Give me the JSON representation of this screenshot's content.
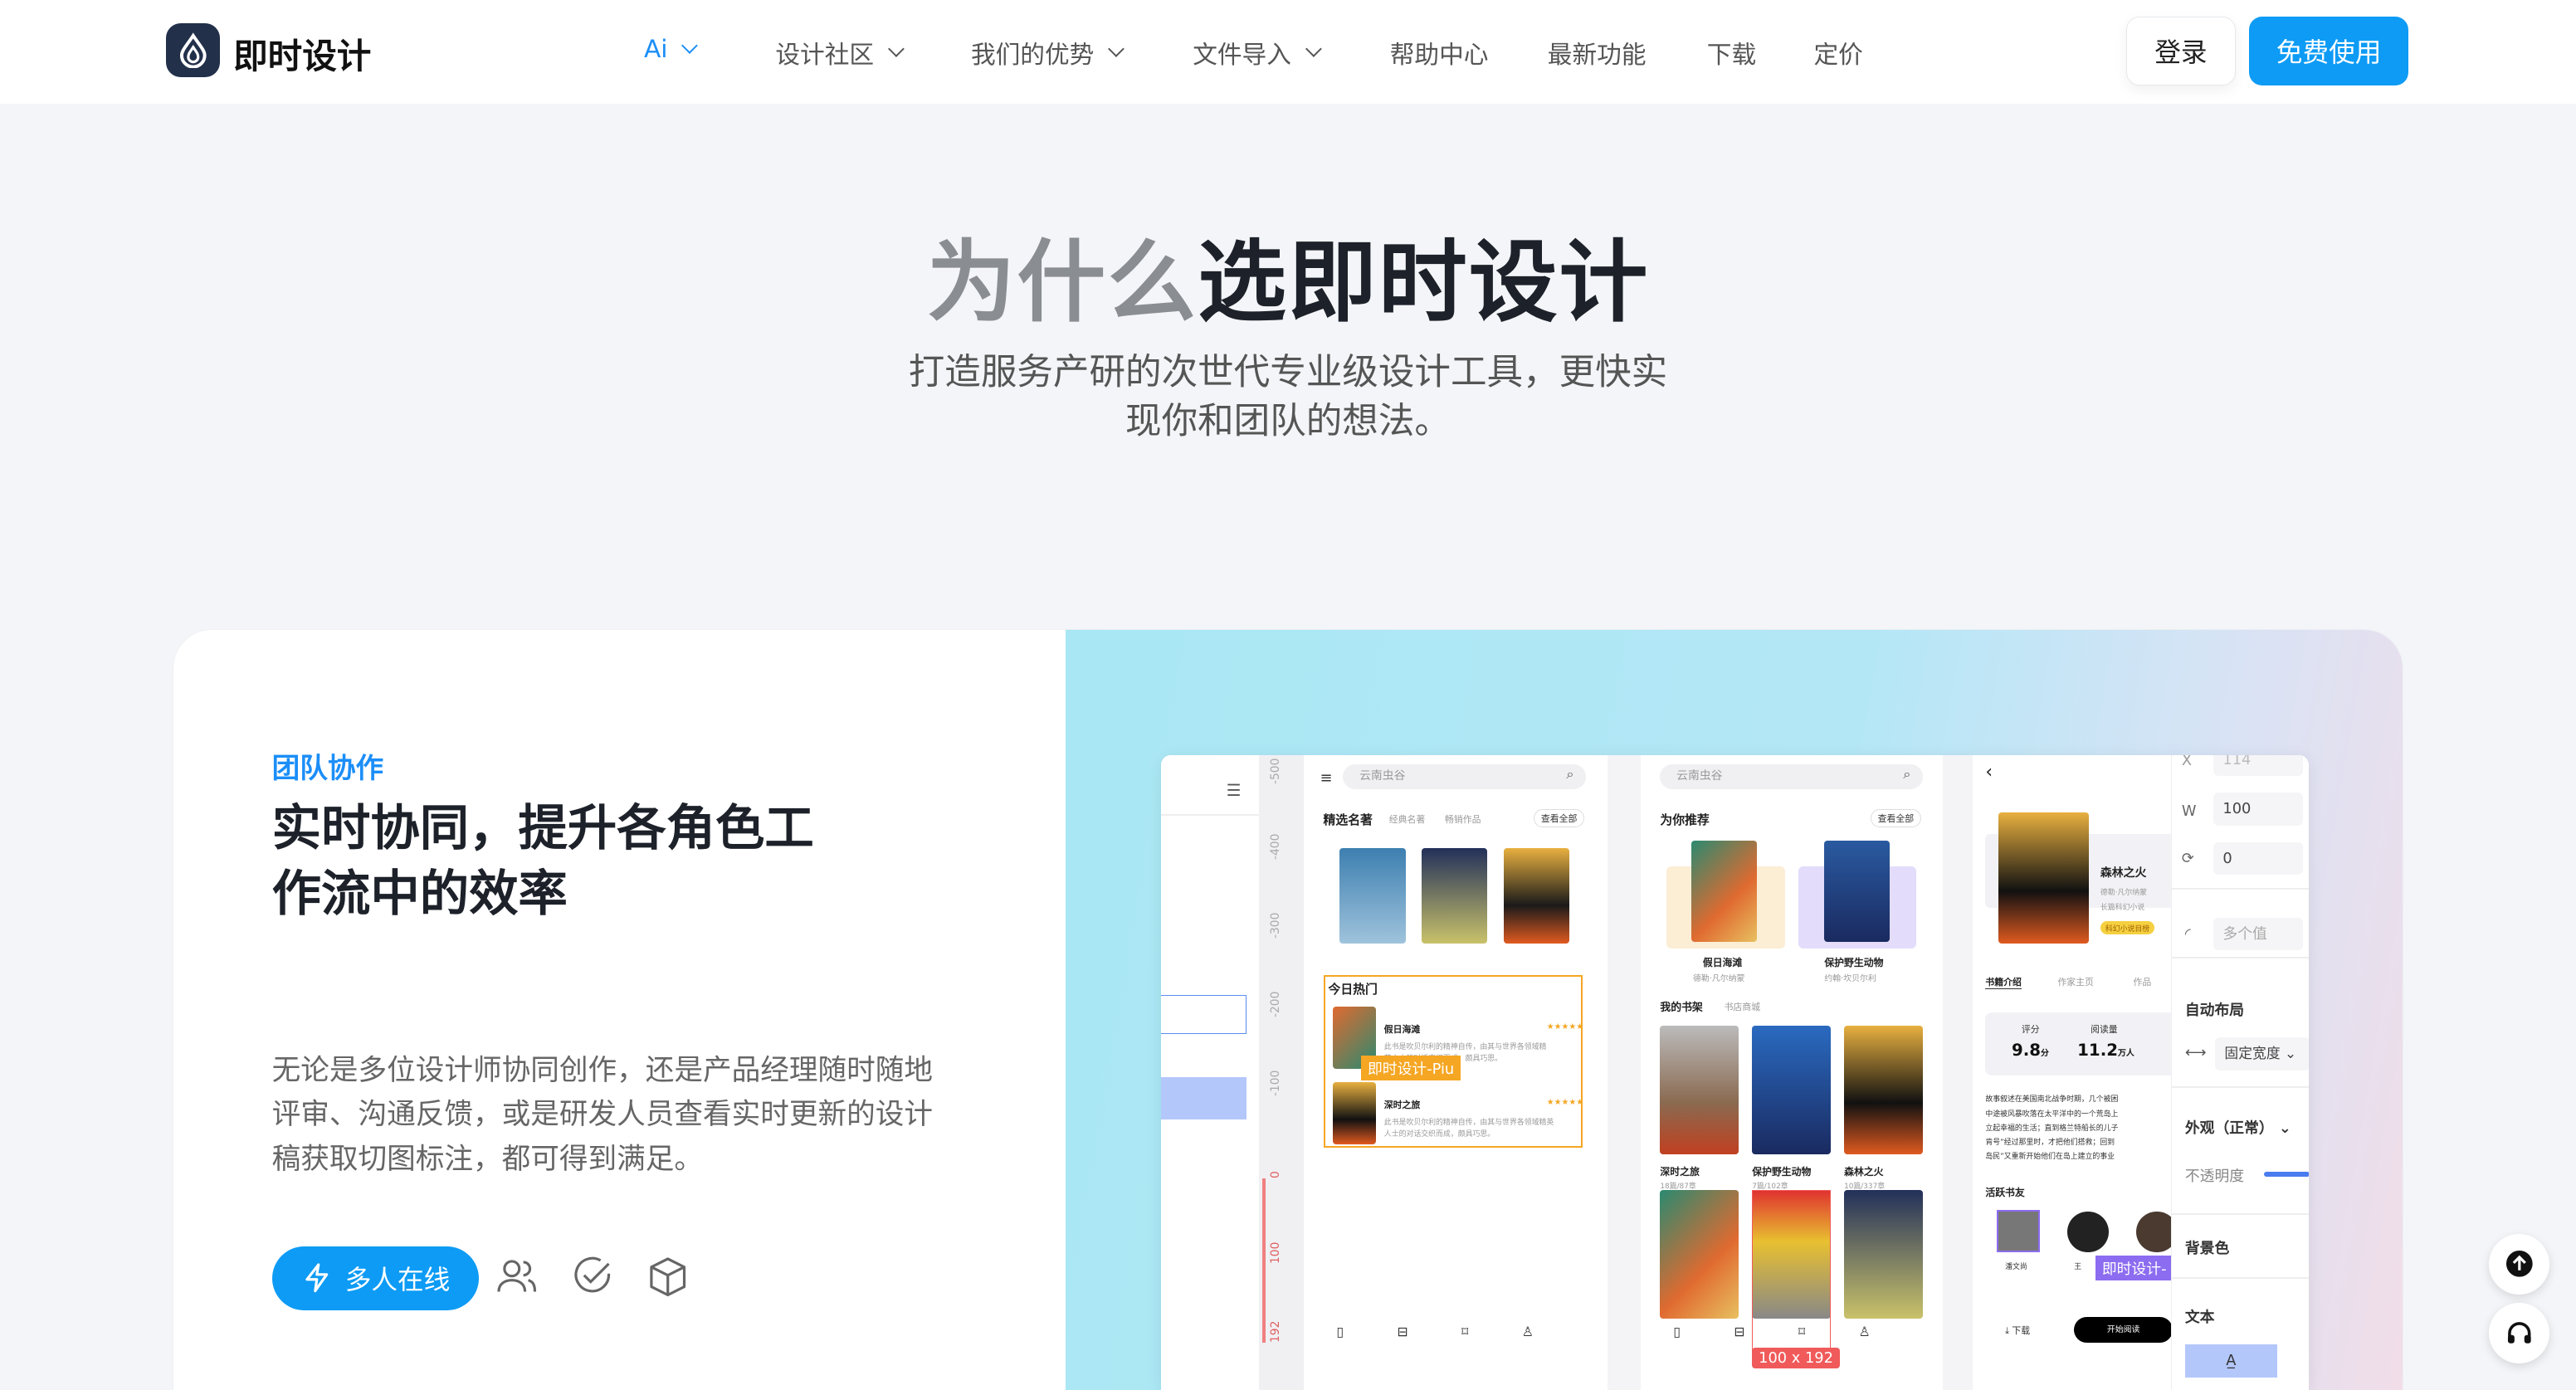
{
  "brand": {
    "name": "即时设计"
  },
  "nav": {
    "items": [
      {
        "label": "Ai",
        "has_dropdown": true,
        "active": true
      },
      {
        "label": "设计社区",
        "has_dropdown": true
      },
      {
        "label": "我们的优势",
        "has_dropdown": true
      },
      {
        "label": "文件导入",
        "has_dropdown": true
      },
      {
        "label": "帮助中心"
      },
      {
        "label": "最新功能"
      },
      {
        "label": "下载"
      },
      {
        "label": "定价"
      }
    ],
    "login": "登录",
    "free": "免费使用"
  },
  "hero": {
    "title_gray": "为什么",
    "title_dark": "选即时设计",
    "subtitle_1": "打造服务产研的次世代专业级设计工具，更快实",
    "subtitle_2": "现你和团队的想法。"
  },
  "feature": {
    "tag": "团队协作",
    "heading_1": "实时协同，提升各角色工",
    "heading_2": "作流中的效率",
    "para_1": "无论是多位设计师协同创作，还是产品经理随时随地",
    "para_2": "评审、沟通反馈，或是研发人员查看实时更新的设计",
    "para_3": "稿获取切图标注，都可得到满足。",
    "button": "多人在线",
    "icons": [
      "users-icon",
      "check-circle-icon",
      "cube-icon"
    ]
  },
  "mockup": {
    "ruler": [
      "-500",
      "-400",
      "-300",
      "-200",
      "-100",
      "0",
      "100",
      "192"
    ],
    "phone1": {
      "search": "云南虫谷",
      "tabs": [
        "精选名著",
        "经典名著",
        "畅销作品"
      ],
      "see_all": "查看全部",
      "hot": "今日热门",
      "items": [
        {
          "title": "假日海滩",
          "desc_1": "此书是吹贝尔利的精神自传，由其与世界各领域精",
          "desc_2": "英人士的对话交织而成，颇具巧思。"
        },
        {
          "title": "深时之旅",
          "desc_1": "此书是吹贝尔利的精神自传，由其与世界各领域精英",
          "desc_2": "人士的对话交织而成，颇具巧思。"
        }
      ],
      "cursor_tag": "即时设计-Piu"
    },
    "phone2": {
      "search": "云南虫谷",
      "section": "为你推荐",
      "see_all": "查看全部",
      "recs": [
        {
          "title": "假日海滩",
          "author": "德勒·凡尔纳蒙"
        },
        {
          "title": "保护野生动物",
          "author": "约翰·坎贝尔利"
        }
      ],
      "shelf_tabs": [
        "我的书架",
        "书店商城"
      ],
      "shelf": [
        {
          "title": "深时之旅",
          "meta": "18篇/87章"
        },
        {
          "title": "保护野生动物",
          "meta": "7篇/102章"
        },
        {
          "title": "森林之火",
          "meta": "10篇/337章"
        }
      ],
      "size_label": "100 x 192"
    },
    "phone3": {
      "title": "森林之火",
      "author": "德勒·凡尔纳蒙",
      "genre": "长篇科幻小说",
      "badge": "科幻小说目榜",
      "tabs": [
        "书籍介绍",
        "作家主页",
        "作品"
      ],
      "score_label": "评分",
      "score": "9.8",
      "score_unit": "分",
      "reads_label": "阅读量",
      "reads": "11.2",
      "reads_unit": "万人",
      "desc": [
        "故事叙述在美国南北战争时期，几个被困",
        "中途被风暴吹落在太平洋中的一个荒岛上",
        "立起幸福的生活；直到格兰特船长的儿子",
        "肯号”经过那里时，才把他们搭救；回到",
        "岛民”又重新开始他们在岛上建立的事业"
      ],
      "friends": "活跃书友",
      "friend_names": [
        "潘文尚",
        "王"
      ],
      "cursor_tag": "即时设计-",
      "download": "下载",
      "read": "开始阅读"
    },
    "props": {
      "x_label": "X",
      "x": "114",
      "w_label": "W",
      "w": "100",
      "rot": "0",
      "radius": "多个值",
      "auto_layout": "自动布局",
      "fixed_width": "固定宽度",
      "appearance": "外观（正常）",
      "opacity": "不透明度",
      "fill": "背景色",
      "text": "文本"
    }
  },
  "colors": {
    "brand": "#0d9bf5",
    "accent_orange": "#f5a623",
    "accent_purple": "#8c6cf0",
    "size_red": "#f05a5a"
  }
}
